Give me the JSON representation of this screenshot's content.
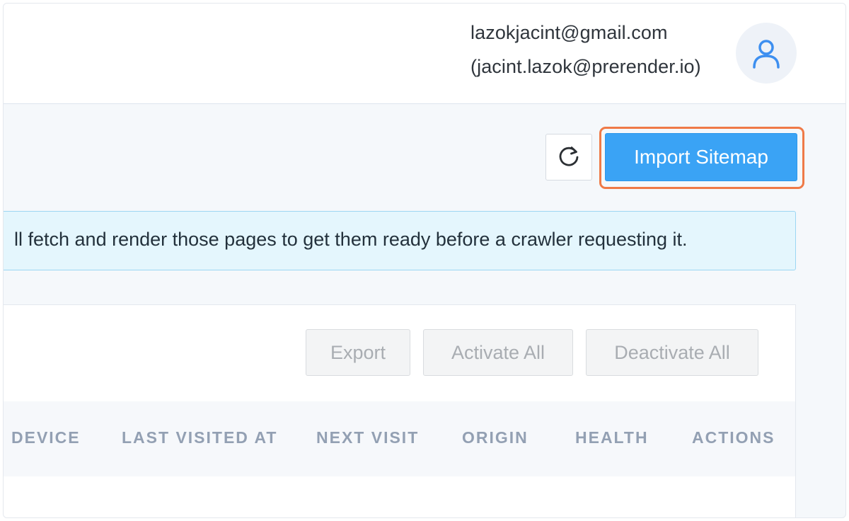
{
  "user": {
    "email": "lazokjacint@gmail.com",
    "alias": "(jacint.lazok@prerender.io)",
    "avatar_icon": "user-icon"
  },
  "toolbar": {
    "refresh_icon": "refresh-icon",
    "import_label": "Import Sitemap"
  },
  "banner": {
    "text": "ll fetch and render those pages to get them ready before a crawler requesting it."
  },
  "actions": {
    "export_label": "Export",
    "activate_all_label": "Activate All",
    "deactivate_all_label": "Deactivate All"
  },
  "table": {
    "columns": [
      "DEVICE",
      "LAST VISITED AT",
      "NEXT VISIT",
      "ORIGIN",
      "HEALTH",
      "ACTIONS"
    ]
  },
  "colors": {
    "primary": "#3aa3f5",
    "highlight": "#ef7a47",
    "info_bg": "#e4f6fd",
    "header_text": "#93a0b3"
  }
}
